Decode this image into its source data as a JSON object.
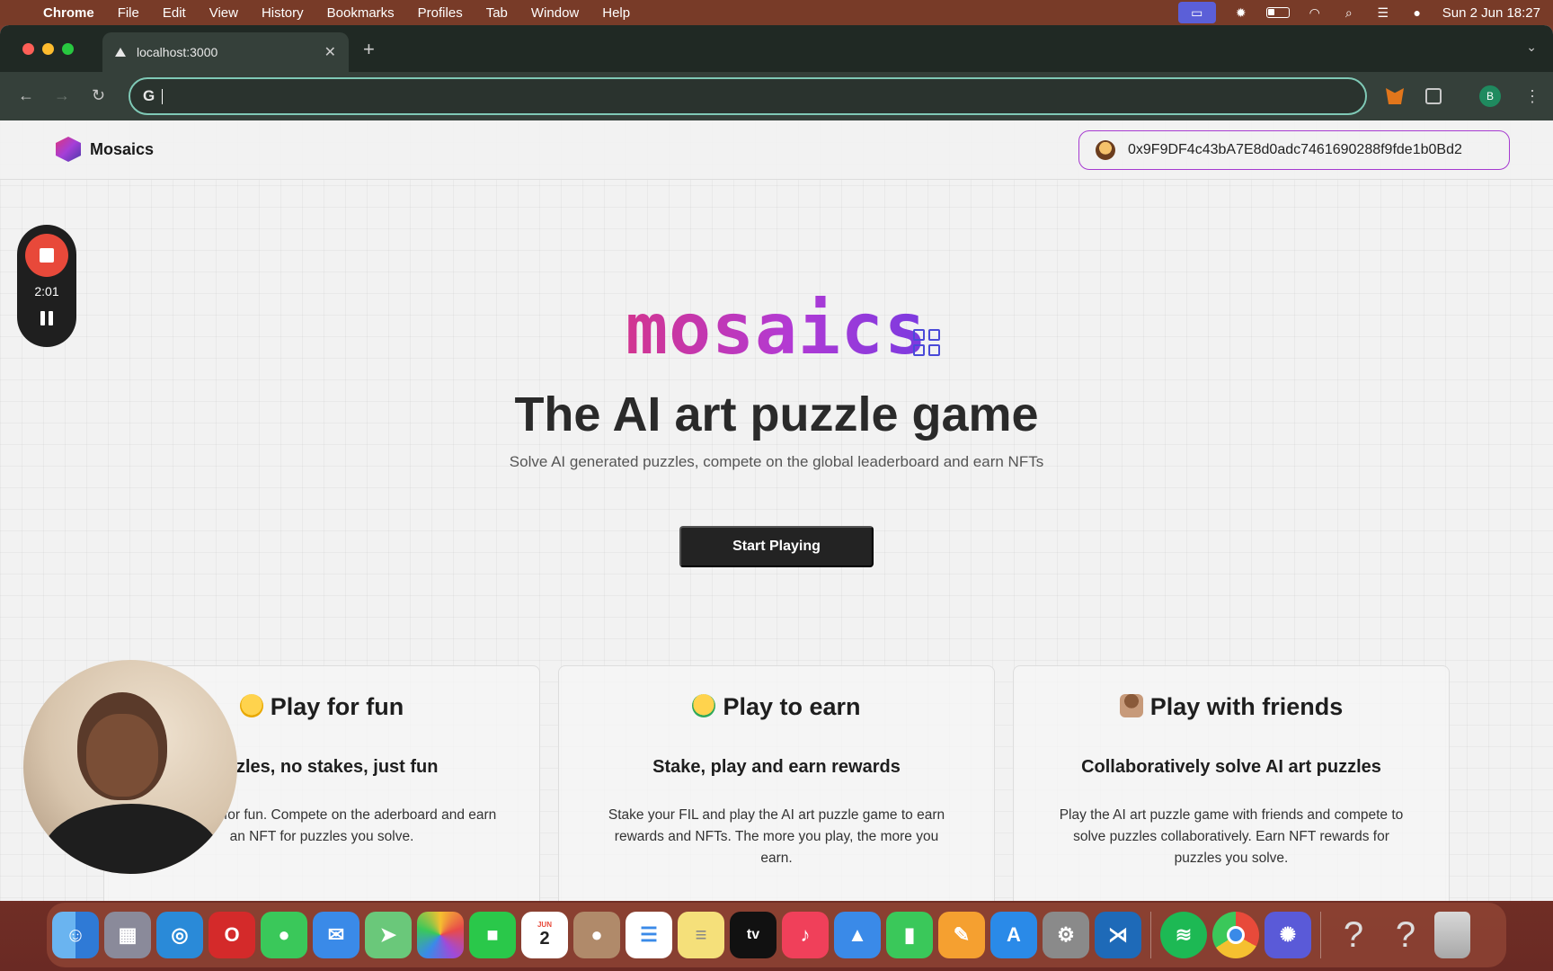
{
  "menubar": {
    "app": "Chrome",
    "items": [
      "File",
      "Edit",
      "View",
      "History",
      "Bookmarks",
      "Profiles",
      "Tab",
      "Window",
      "Help"
    ],
    "clock": "Sun 2 Jun  18:27"
  },
  "browser": {
    "tab_title": "localhost:3000",
    "address_value": "",
    "profile_initial": "B"
  },
  "site": {
    "brand": "Mosaics",
    "wallet_address": "0x9F9DF4c43bA7E8d0adc7461690288f9fde1b0Bd2",
    "logo_word": "mosaics",
    "title": "The AI art puzzle game",
    "subtitle": "Solve AI generated puzzles, compete on the global leaderboard and earn NFTs",
    "cta": "Start Playing"
  },
  "cards": [
    {
      "title": "Play for fun",
      "heading": "puzzles, no stakes, just fun",
      "body": "puzzles just for fun. Compete on the aderboard and earn an NFT for puzzles you solve."
    },
    {
      "title": "Play to earn",
      "heading": "Stake, play and earn rewards",
      "body": "Stake your FIL and play the AI art puzzle game to earn rewards and NFTs. The more you play, the more you earn."
    },
    {
      "title": "Play with friends",
      "heading": "Collaboratively solve AI art puzzles",
      "body": "Play the AI art puzzle game with friends and compete to solve puzzles collaboratively. Earn NFT rewards for puzzles you solve."
    }
  ],
  "recorder": {
    "time": "2:01"
  },
  "dock": {
    "calendar_day": "2",
    "calendar_month": "JUN",
    "tv_label": "tv",
    "help_glyph": "?"
  },
  "colors": {
    "accent_purple": "#a63ad0",
    "logo_gradient_start": "#d23590",
    "logo_gradient_end": "#7a3ae0",
    "cta_bg": "#232323",
    "omnibox_border": "#7fc9b6"
  }
}
